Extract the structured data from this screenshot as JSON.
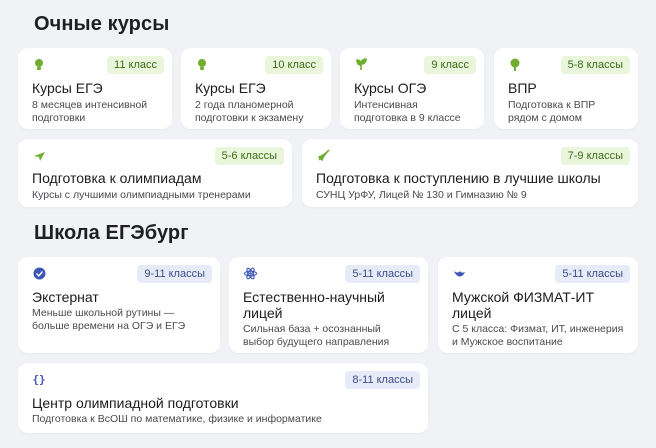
{
  "sections": {
    "ochnye": {
      "title": "Очные курсы",
      "cards": [
        {
          "title": "Курсы ЕГЭ",
          "badge": "11 класс",
          "desc1": "8 месяцев интенсивной",
          "desc2": "подготовки",
          "icon": "lightbulb-icon"
        },
        {
          "title": "Курсы ЕГЭ",
          "badge": "10 класс",
          "desc1": "2 года планомерной",
          "desc2": "подготовки к экзамену",
          "icon": "lightbulb-icon"
        },
        {
          "title": "Курсы ОГЭ",
          "badge": "9 класс",
          "desc1": "Интенсивная",
          "desc2": "подготовка в 9 классе",
          "icon": "sprout-icon"
        },
        {
          "title": "ВПР",
          "badge": "5-8 классы",
          "desc1": "Подготовка к ВПР",
          "desc2": "рядом с домом",
          "icon": "seedling-icon"
        },
        {
          "title": "Подготовка к олимпиадам",
          "badge": "5-6 классы",
          "desc1": "Курсы с лучшими олимпиадными тренерами",
          "desc2": "",
          "icon": "airplane-icon"
        },
        {
          "title": "Подготовка к поступлению в лучшие школы",
          "badge": "7-9 классы",
          "desc1": "СУНЦ УрФУ, Лицей № 130 и Гимназию № 9",
          "desc2": "",
          "icon": "rocket-icon"
        }
      ]
    },
    "egeburg": {
      "title": "Школа ЕГЭбург",
      "cards": [
        {
          "title1": "Экстернат",
          "title2": "",
          "badge": "9-11 классы",
          "desc1": "Меньше школьной рутины —",
          "desc2": "больше времени на ОГЭ и ЕГЭ",
          "icon": "check-badge-icon"
        },
        {
          "title1": "Естественно-научный",
          "title2": "лицей",
          "badge": "5-11 классы",
          "desc1": "Сильная база + осознанный",
          "desc2": "выбор будущего направления",
          "icon": "atom-icon"
        },
        {
          "title1": "Мужской ФИЗМАТ-ИТ",
          "title2": "лицей",
          "badge": "5-11 классы",
          "desc1": "С 5 класса: Физмат, ИТ, инженерия",
          "desc2": "и Мужское воспитание",
          "icon": "bird-icon"
        },
        {
          "title1": "Центр олимпиадной подготовки",
          "title2": "",
          "badge": "8-11 классы",
          "desc1": "Подготовка к ВсОШ по математике, физике и информатике",
          "desc2": "",
          "icon": "code-braces-icon"
        }
      ]
    }
  },
  "colors": {
    "green_icon": "#6fae2e",
    "blue_icon": "#3d56b5",
    "green_badge_bg": "#eaf6dc",
    "blue_badge_bg": "#e7ebf7"
  }
}
